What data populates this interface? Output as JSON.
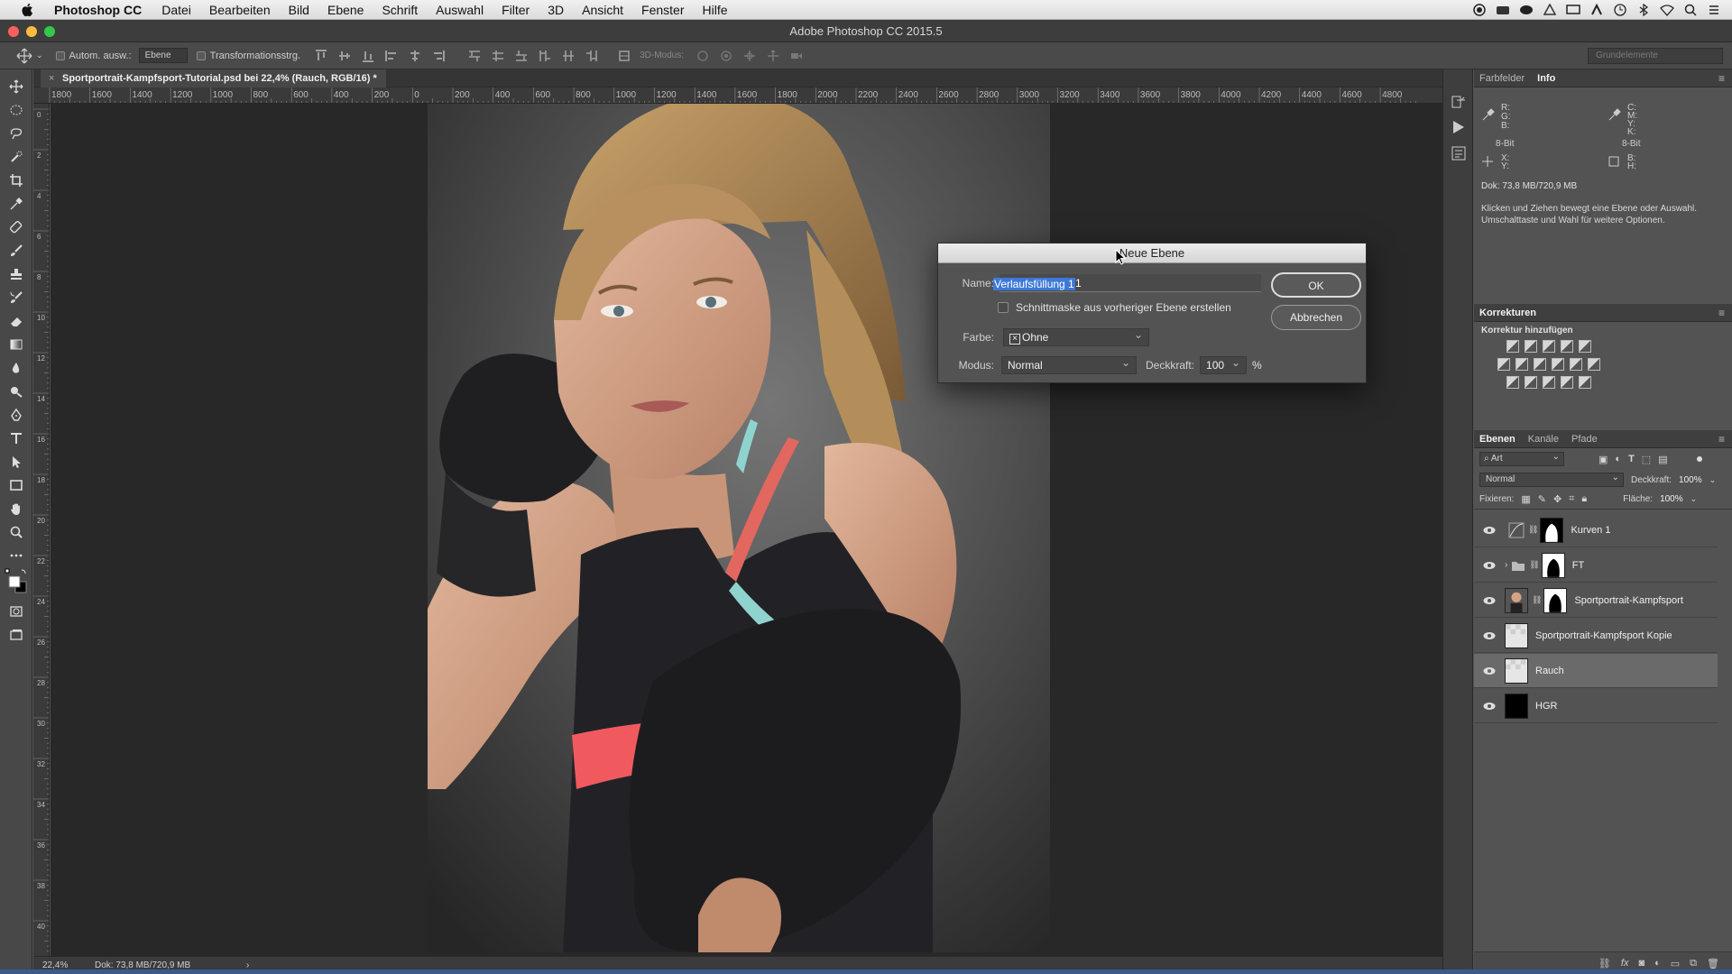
{
  "menubar": {
    "app": "Photoshop CC",
    "items": [
      "Datei",
      "Bearbeiten",
      "Bild",
      "Ebene",
      "Schrift",
      "Auswahl",
      "Filter",
      "3D",
      "Ansicht",
      "Fenster",
      "Hilfe"
    ]
  },
  "window": {
    "title": "Adobe Photoshop CC 2015.5"
  },
  "options": {
    "autoselect_label": "Autom. ausw.:",
    "autoselect_value": "Ebene",
    "transform_label": "Transformationsstrg.",
    "mode3d_label": "3D-Modus:",
    "workspace": "Grundelemente"
  },
  "document": {
    "tab_title": "Sportportrait-Kampfsport-Tutorial.psd bei 22,4% (Rauch, RGB/16) *",
    "close": "×",
    "zoom": "22,4%",
    "doc_size": "Dok: 73,8 MB/720,9 MB",
    "status_arrow": "›"
  },
  "ruler_h": [
    "1800",
    "1600",
    "1400",
    "1200",
    "1000",
    "800",
    "600",
    "400",
    "200",
    "0",
    "200",
    "400",
    "600",
    "800",
    "1000",
    "1200",
    "1400",
    "1600",
    "1800",
    "2000",
    "2200",
    "2400",
    "2600",
    "2800",
    "3000",
    "3200",
    "3400",
    "3600",
    "3800",
    "4000",
    "4200",
    "4400",
    "4600",
    "4800"
  ],
  "ruler_v": [
    "0",
    "2",
    "4",
    "6",
    "8",
    "10",
    "12",
    "14",
    "16",
    "18",
    "20",
    "22",
    "24",
    "26",
    "28",
    "30",
    "32",
    "34",
    "36",
    "38",
    "40"
  ],
  "info_panel": {
    "tabs": [
      "Farbfelder",
      "Info"
    ],
    "rgb": [
      "R:",
      "G:",
      "B:"
    ],
    "cmyk": [
      "C:",
      "M:",
      "Y:",
      "K:"
    ],
    "bit_left": "8-Bit",
    "bit_right": "8-Bit",
    "xy": [
      "X:",
      "Y:"
    ],
    "bh": [
      "B:",
      "H:"
    ],
    "doc": "Dok: 73,8 MB/720,9 MB",
    "hint": "Klicken und Ziehen bewegt eine Ebene oder Auswahl. Umschalttaste und Wahl für weitere Optionen."
  },
  "corrections": {
    "title": "Korrekturen",
    "subtitle": "Korrektur hinzufügen"
  },
  "layers_panel": {
    "tabs": [
      "Ebenen",
      "Kanäle",
      "Pfade"
    ],
    "filter": "Art",
    "blend": "Normal",
    "opacity_label": "Deckkraft:",
    "opacity": "100%",
    "lock_label": "Fixieren:",
    "fill_label": "Fläche:",
    "fill": "100%",
    "layers": [
      {
        "name": "Kurven 1"
      },
      {
        "name": "FT"
      },
      {
        "name": "Sportportrait-Kampfsport"
      },
      {
        "name": "Sportportrait-Kampfsport Kopie"
      },
      {
        "name": "Rauch"
      },
      {
        "name": "HGR"
      }
    ]
  },
  "dialog": {
    "title": "Neue Ebene",
    "name_label": "Name:",
    "name_value": "Verlaufsfüllung 1",
    "clip_label": "Schnittmaske aus vorheriger Ebene erstellen",
    "color_label": "Farbe:",
    "color_value": "Ohne",
    "mode_label": "Modus:",
    "mode_value": "Normal",
    "opacity_label": "Deckkraft:",
    "opacity_value": "100",
    "percent": "%",
    "ok": "OK",
    "cancel": "Abbrechen"
  }
}
